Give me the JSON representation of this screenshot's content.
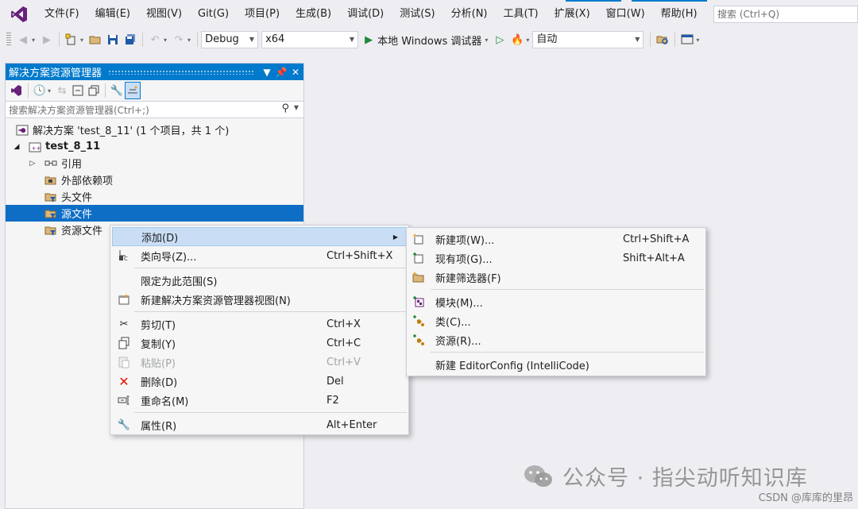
{
  "menubar": {
    "items": [
      "文件(F)",
      "编辑(E)",
      "视图(V)",
      "Git(G)",
      "项目(P)",
      "生成(B)",
      "调试(D)",
      "测试(S)",
      "分析(N)",
      "工具(T)",
      "扩展(X)",
      "窗口(W)",
      "帮助(H)"
    ],
    "search_placeholder": "搜索 (Ctrl+Q)"
  },
  "toolbar": {
    "config": "Debug",
    "platform": "x64",
    "run_label": "本地 Windows 调试器",
    "auto_label": "自动"
  },
  "solution_explorer": {
    "title": "解决方案资源管理器",
    "search_placeholder": "搜索解决方案资源管理器(Ctrl+;)",
    "tree": [
      {
        "label": "解决方案 'test_8_11' (1 个项目，共 1 个)"
      },
      {
        "label": "test_8_11"
      },
      {
        "label": "引用"
      },
      {
        "label": "外部依赖项"
      },
      {
        "label": "头文件"
      },
      {
        "label": "源文件"
      },
      {
        "label": "资源文件"
      }
    ]
  },
  "context_menu": {
    "items": [
      {
        "label": "添加(D)",
        "shortcut": ""
      },
      {
        "label": "类向导(Z)...",
        "shortcut": "Ctrl+Shift+X"
      },
      {
        "label": "限定为此范围(S)",
        "shortcut": ""
      },
      {
        "label": "新建解决方案资源管理器视图(N)",
        "shortcut": ""
      },
      {
        "label": "剪切(T)",
        "shortcut": "Ctrl+X"
      },
      {
        "label": "复制(Y)",
        "shortcut": "Ctrl+C"
      },
      {
        "label": "粘贴(P)",
        "shortcut": "Ctrl+V"
      },
      {
        "label": "删除(D)",
        "shortcut": "Del"
      },
      {
        "label": "重命名(M)",
        "shortcut": "F2"
      },
      {
        "label": "属性(R)",
        "shortcut": "Alt+Enter"
      }
    ]
  },
  "submenu": {
    "items": [
      {
        "label": "新建项(W)...",
        "shortcut": "Ctrl+Shift+A"
      },
      {
        "label": "现有项(G)...",
        "shortcut": "Shift+Alt+A"
      },
      {
        "label": "新建筛选器(F)",
        "shortcut": ""
      },
      {
        "label": "模块(M)...",
        "shortcut": ""
      },
      {
        "label": "类(C)...",
        "shortcut": ""
      },
      {
        "label": "资源(R)...",
        "shortcut": ""
      },
      {
        "label": "新建 EditorConfig (IntelliCode)",
        "shortcut": ""
      }
    ]
  },
  "watermark": {
    "text": "公众号 · 指尖动听知识库",
    "credit": "CSDN @库库的里昂"
  },
  "colors": {
    "accent": "#007acc",
    "selection": "#0e6ec6",
    "menu_highlight": "#c9def5",
    "vs_purple": "#68217a"
  }
}
